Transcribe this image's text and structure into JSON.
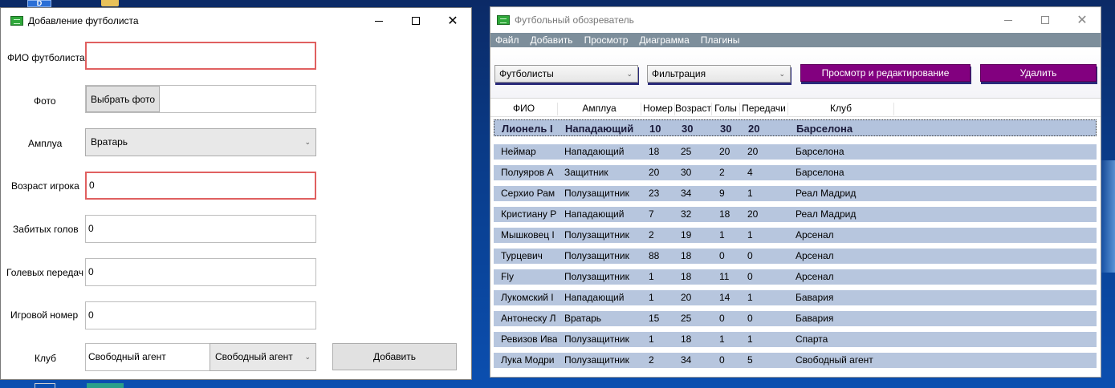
{
  "desktop": {
    "icons": [
      "app-shortcut-icon",
      "folder-icon",
      "monitor-icon",
      "app-icon"
    ],
    "partial_icon_text": "D"
  },
  "add_dialog": {
    "title": "Добавление футболиста",
    "fields": {
      "name": {
        "label": "ФИО футболиста",
        "value": ""
      },
      "photo": {
        "label": "Фото",
        "button": "Выбрать фото",
        "value": ""
      },
      "role": {
        "label": "Амплуа",
        "value": "Вратарь"
      },
      "age": {
        "label": "Возраст игрока",
        "value": "0"
      },
      "goals": {
        "label": "Забитых голов",
        "value": "0"
      },
      "assists": {
        "label": "Голевых передач",
        "value": "0"
      },
      "number": {
        "label": "Игровой номер",
        "value": "0"
      },
      "club": {
        "label": "Клуб",
        "value": "Свободный агент",
        "select": "Свободный агент"
      }
    },
    "add_button": "Добавить",
    "error_color": "#e06060"
  },
  "browser": {
    "title": "Футбольный обозреватель",
    "menu": [
      "Файл",
      "Добавить",
      "Просмотр",
      "Диаграмма",
      "Плагины"
    ],
    "toolbar": {
      "type_select": "Футболисты",
      "filter_select": "Фильтрация",
      "view_edit_button": "Просмотр и редактирование",
      "delete_button": "Удалить",
      "accent_color": "#82007f"
    },
    "columns": [
      "ФИО",
      "Амплуа",
      "Номер",
      "Возраст",
      "Голы",
      "Передачи",
      "Клуб"
    ],
    "rows": [
      [
        "Лионель I",
        "Нападающий",
        "10",
        "30",
        "30",
        "20",
        "Барселона"
      ],
      [
        "Неймар",
        "Нападающий",
        "18",
        "25",
        "20",
        "20",
        "Барселона"
      ],
      [
        "Полуяров А",
        "Защитник",
        "20",
        "30",
        "2",
        "4",
        "Барселона"
      ],
      [
        "Серхио Рам",
        "Полузащитник",
        "23",
        "34",
        "9",
        "1",
        "Реал Мадрид"
      ],
      [
        "Кристиану Р",
        "Нападающий",
        "7",
        "32",
        "18",
        "20",
        "Реал Мадрид"
      ],
      [
        "Мышковец I",
        "Полузащитник",
        "2",
        "19",
        "1",
        "1",
        "Арсенал"
      ],
      [
        "Турцевич",
        "Полузащитник",
        "88",
        "18",
        "0",
        "0",
        "Арсенал"
      ],
      [
        "Fly",
        "Полузащитник",
        "1",
        "18",
        "11",
        "0",
        "Арсенал"
      ],
      [
        "Лукомский I",
        "Нападающий",
        "1",
        "20",
        "14",
        "1",
        "Бавария"
      ],
      [
        "Антонеску Л",
        "Вратарь",
        "15",
        "25",
        "0",
        "0",
        "Бавария"
      ],
      [
        "Ревизов Ива",
        "Полузащитник",
        "1",
        "18",
        "1",
        "1",
        "Спарта"
      ],
      [
        "Лука Модри",
        "Полузащитник",
        "2",
        "34",
        "0",
        "5",
        "Свободный агент"
      ]
    ],
    "row_color": "#b7c6de"
  }
}
